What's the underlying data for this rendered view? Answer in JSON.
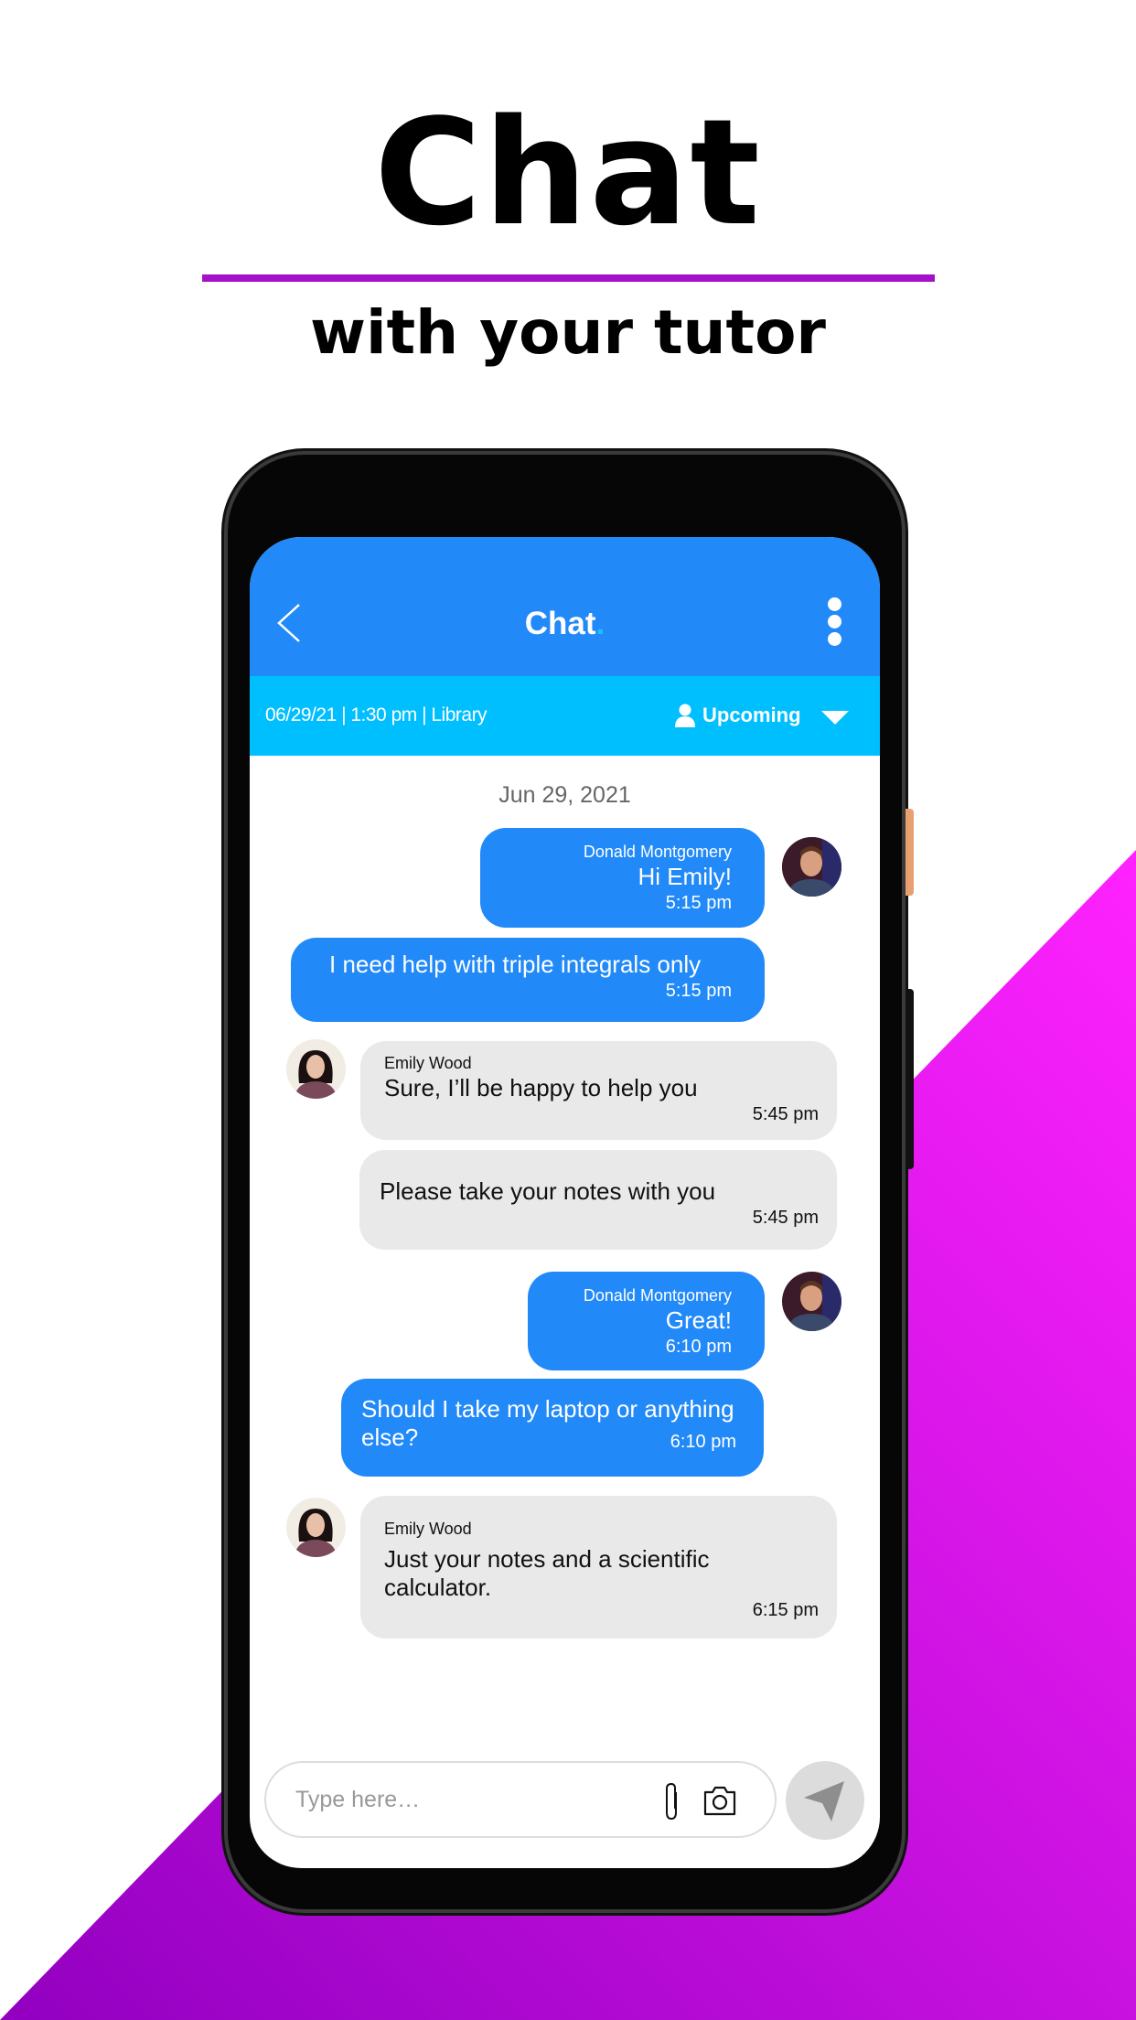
{
  "promo": {
    "headline": "Chat",
    "subheadline": "with your tutor",
    "accent_color": "#a511c9",
    "background_gradient": [
      "#9200c0",
      "#ff22ff"
    ]
  },
  "header": {
    "title": "Chat",
    "title_dot": ".",
    "back_icon": "chevron-left-icon",
    "menu_icon": "kebab-icon",
    "color": "#2189f8"
  },
  "session": {
    "info": "06/29/21 | 1:30 pm | Library",
    "status": "Upcoming",
    "status_icon": "person-icon",
    "dropdown_icon": "caret-down-icon",
    "color": "#00bfff"
  },
  "chat": {
    "date": "Jun 29, 2021",
    "messages": [
      {
        "sender": "Donald Montgomery",
        "text": "Hi Emily!",
        "time": "5:15 pm"
      },
      {
        "text": "I need help with triple integrals only",
        "time": "5:15 pm"
      },
      {
        "sender": "Emily Wood",
        "text": "Sure, I’ll be happy to help you",
        "time": "5:45 pm"
      },
      {
        "text": "Please take your notes with you",
        "time": "5:45 pm"
      },
      {
        "sender": "Donald Montgomery",
        "text": "Great!",
        "time": "6:10 pm"
      },
      {
        "text": "Should I take my laptop or anything else?",
        "time": "6:10 pm"
      },
      {
        "sender": "Emily Wood",
        "text": "Just your notes and a scientific calculator.",
        "time": "6:15 pm"
      }
    ]
  },
  "composer": {
    "placeholder": "Type here…",
    "attach_icon": "paperclip-icon",
    "camera_icon": "camera-icon",
    "send_icon": "send-icon"
  }
}
